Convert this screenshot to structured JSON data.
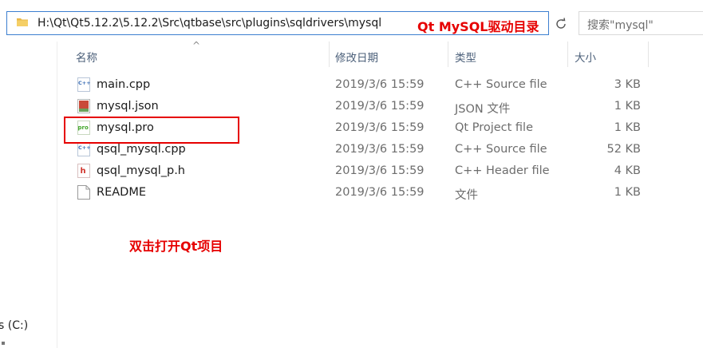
{
  "address_bar": {
    "path": "H:\\Qt\\Qt5.12.2\\5.12.2\\Src\\qtbase\\src\\plugins\\sqldrivers\\mysql"
  },
  "search": {
    "placeholder": "搜索\"mysql\""
  },
  "columns": {
    "name": "名称",
    "date": "修改日期",
    "type": "类型",
    "size": "大小"
  },
  "files": [
    {
      "name": "main.cpp",
      "date": "2019/3/6 15:59",
      "type": "C++ Source file",
      "size": "3 KB",
      "icon": "cpp-file-icon"
    },
    {
      "name": "mysql.json",
      "date": "2019/3/6 15:59",
      "type": "JSON 文件",
      "size": "1 KB",
      "icon": "json-file-icon"
    },
    {
      "name": "mysql.pro",
      "date": "2019/3/6 15:59",
      "type": "Qt Project file",
      "size": "1 KB",
      "icon": "pro-file-icon"
    },
    {
      "name": "qsql_mysql.cpp",
      "date": "2019/3/6 15:59",
      "type": "C++ Source file",
      "size": "52 KB",
      "icon": "cpp-file-icon"
    },
    {
      "name": "qsql_mysql_p.h",
      "date": "2019/3/6 15:59",
      "type": "C++ Header file",
      "size": "4 KB",
      "icon": "header-file-icon"
    },
    {
      "name": "README",
      "date": "2019/3/6 15:59",
      "type": "文件",
      "size": "1 KB",
      "icon": "generic-file-icon"
    }
  ],
  "nav": {
    "drive_label": "s (C:)"
  },
  "annotations": {
    "title": "Qt MySQL驱动目录",
    "hint": "双击打开Qt项目"
  },
  "colors": {
    "annotation_red": "#e60000",
    "header_text": "#4c607a",
    "accent_blue": "#3c7fd0"
  }
}
